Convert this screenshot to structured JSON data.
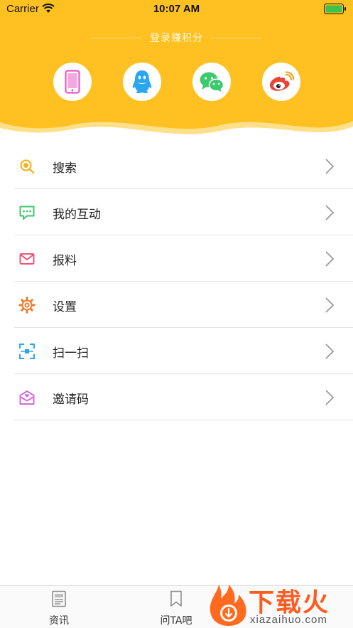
{
  "status_bar": {
    "carrier": "Carrier",
    "time": "10:07 AM"
  },
  "colors": {
    "accent": "#ffc121",
    "wave_light": "#ffe08a",
    "qq_blue": "#2aa6f0",
    "wechat_green": "#3dc96e",
    "weibo_red": "#e9443a",
    "phone_pink": "#e85ac6"
  },
  "header": {
    "login_text": "登录赚积分",
    "social": [
      {
        "icon": "phone-icon"
      },
      {
        "icon": "qq-icon"
      },
      {
        "icon": "wechat-icon"
      },
      {
        "icon": "weibo-icon"
      }
    ]
  },
  "menu": {
    "items": [
      {
        "label": "搜索",
        "icon": "search-icon"
      },
      {
        "label": "我的互动",
        "icon": "chat-icon"
      },
      {
        "label": "报料",
        "icon": "mail-icon"
      },
      {
        "label": "设置",
        "icon": "gear-icon"
      },
      {
        "label": "扫一扫",
        "icon": "scan-icon"
      },
      {
        "label": "邀请码",
        "icon": "invite-icon"
      }
    ]
  },
  "tabbar": {
    "tabs": [
      {
        "label": "资讯",
        "icon": "news-icon"
      },
      {
        "label": "问TA吧",
        "icon": "bookmark-icon"
      }
    ]
  },
  "watermark": {
    "title": "下载火",
    "site": "xiazaihuo.com"
  }
}
